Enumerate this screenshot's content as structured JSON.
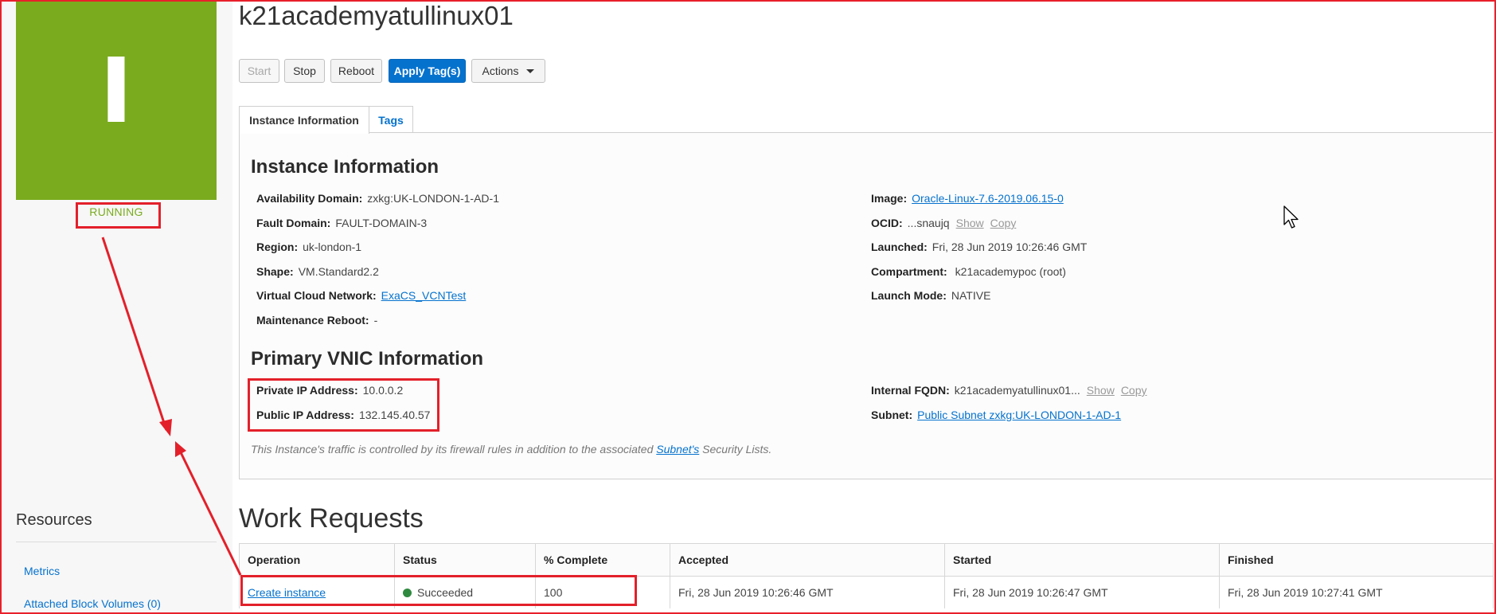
{
  "instance": {
    "title": "k21academyatullinux01",
    "status_tile_letter": "I",
    "state": "RUNNING",
    "state_color": "#7aab1e"
  },
  "toolbar": {
    "start_label": "Start",
    "stop_label": "Stop",
    "reboot_label": "Reboot",
    "apply_tags_label": "Apply Tag(s)",
    "actions_label": "Actions"
  },
  "tabs": [
    {
      "label": "Instance Information",
      "active": true
    },
    {
      "label": "Tags",
      "active": false
    }
  ],
  "instance_info": {
    "heading": "Instance Information",
    "availability_domain": {
      "label": "Availability Domain:",
      "value": "zxkg:UK-LONDON-1-AD-1"
    },
    "fault_domain": {
      "label": "Fault Domain:",
      "value": "FAULT-DOMAIN-3"
    },
    "region": {
      "label": "Region:",
      "value": "uk-london-1"
    },
    "shape": {
      "label": "Shape:",
      "value": "VM.Standard2.2"
    },
    "vcn": {
      "label": "Virtual Cloud Network:",
      "value": "ExaCS_VCNTest"
    },
    "maintenance_reboot": {
      "label": "Maintenance Reboot:",
      "value": "-"
    },
    "image": {
      "label": "Image:",
      "value": "Oracle-Linux-7.6-2019.06.15-0"
    },
    "ocid": {
      "label": "OCID:",
      "value": "...snaujq",
      "show": "Show",
      "copy": "Copy"
    },
    "launched": {
      "label": "Launched:",
      "value": "Fri, 28 Jun 2019 10:26:46 GMT"
    },
    "compartment": {
      "label": "Compartment:",
      "value": "k21academypoc (root)"
    },
    "launch_mode": {
      "label": "Launch Mode:",
      "value": "NATIVE"
    }
  },
  "vnic_info": {
    "heading": "Primary VNIC Information",
    "private_ip": {
      "label": "Private IP Address:",
      "value": "10.0.0.2"
    },
    "public_ip": {
      "label": "Public IP Address:",
      "value": "132.145.40.57"
    },
    "internal_fqdn": {
      "label": "Internal FQDN:",
      "value": "k21academyatullinux01...",
      "show": "Show",
      "copy": "Copy"
    },
    "subnet": {
      "label": "Subnet:",
      "value": "Public Subnet zxkg:UK-LONDON-1-AD-1"
    },
    "note_prefix": "This Instance's traffic is controlled by its firewall rules in addition to the associated ",
    "note_link": "Subnet's",
    "note_suffix": " Security Lists."
  },
  "resources": {
    "title": "Resources",
    "items": [
      "Metrics",
      "Attached Block Volumes (0)"
    ]
  },
  "work_requests": {
    "title": "Work Requests",
    "columns": [
      "Operation",
      "Status",
      "% Complete",
      "Accepted",
      "Started",
      "Finished"
    ],
    "rows": [
      {
        "operation": "Create instance",
        "status": "Succeeded",
        "percent_complete": "100",
        "accepted": "Fri, 28 Jun 2019 10:26:46 GMT",
        "started": "Fri, 28 Jun 2019 10:26:47 GMT",
        "finished": "Fri, 28 Jun 2019 10:27:41 GMT"
      }
    ]
  },
  "colors": {
    "accent": "#0572ce",
    "running_green": "#7aab1e",
    "succeeded_green": "#2f8a3f",
    "annotation_red": "#e3202a"
  }
}
